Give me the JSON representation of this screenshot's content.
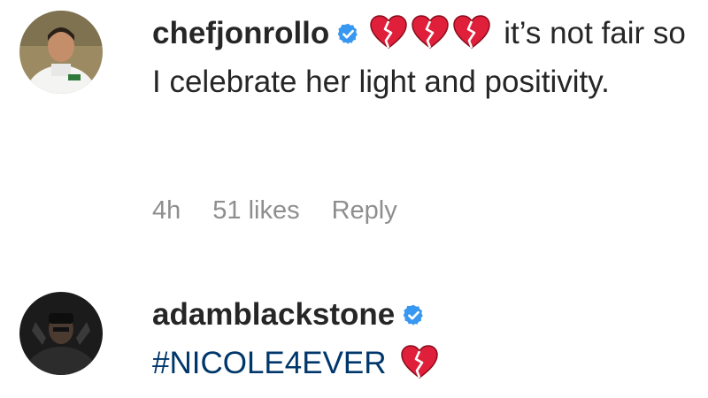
{
  "comments": [
    {
      "username": "chefjonrollo",
      "verified": true,
      "hearts": [
        "broken-heart-icon",
        "broken-heart-icon",
        "broken-heart-icon"
      ],
      "text": "it’s not fair so I celebrate her light and positivity.",
      "time": "4h",
      "likes": "51 likes",
      "reply_label": "Reply"
    },
    {
      "username": "adamblackstone",
      "verified": true,
      "hashtag": "#NICOLE4EVER",
      "trailing_icon": "broken-heart-icon"
    }
  ],
  "colors": {
    "verified_badge": "#3897f0",
    "broken_heart": "#e0203a",
    "hashtag": "#00376b",
    "meta_text": "#8e8e8e"
  }
}
